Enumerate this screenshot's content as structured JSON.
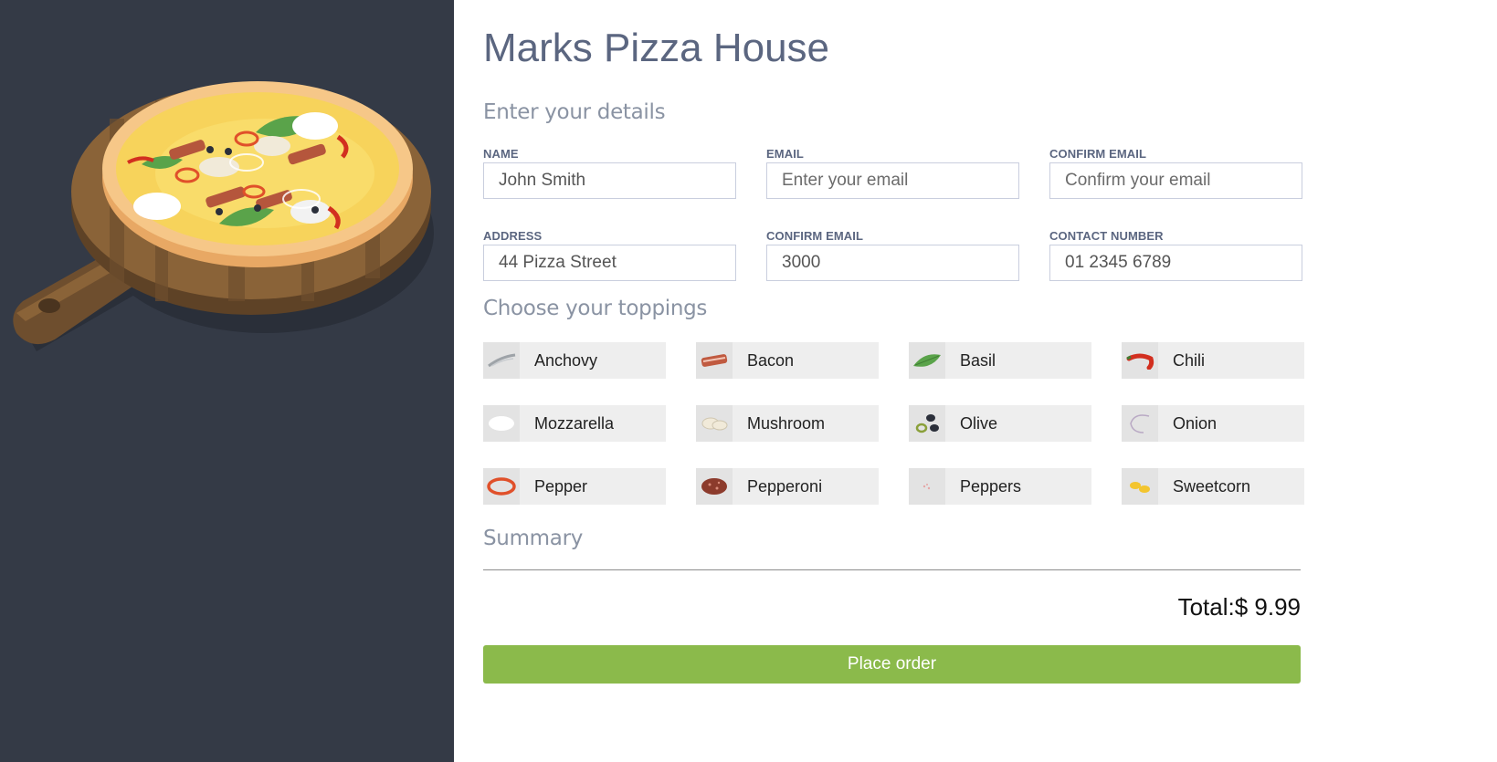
{
  "app": {
    "title": "Marks Pizza House"
  },
  "details": {
    "heading": "Enter your details",
    "fields": [
      {
        "label": "NAME",
        "value": "John Smith",
        "placeholder": ""
      },
      {
        "label": "EMAIL",
        "value": "",
        "placeholder": "Enter your email"
      },
      {
        "label": "CONFIRM EMAIL",
        "value": "",
        "placeholder": "Confirm your email"
      },
      {
        "label": "ADDRESS",
        "value": "44 Pizza Street",
        "placeholder": ""
      },
      {
        "label": "CONFIRM EMAIL",
        "value": "3000",
        "placeholder": ""
      },
      {
        "label": "CONTACT NUMBER",
        "value": "01 2345 6789",
        "placeholder": ""
      }
    ]
  },
  "toppings": {
    "heading": "Choose your toppings",
    "items": [
      {
        "label": "Anchovy",
        "icon": "anchovy-icon"
      },
      {
        "label": "Bacon",
        "icon": "bacon-icon"
      },
      {
        "label": "Basil",
        "icon": "basil-icon"
      },
      {
        "label": "Chili",
        "icon": "chili-icon"
      },
      {
        "label": "Mozzarella",
        "icon": "mozzarella-icon"
      },
      {
        "label": "Mushroom",
        "icon": "mushroom-icon"
      },
      {
        "label": "Olive",
        "icon": "olive-icon"
      },
      {
        "label": "Onion",
        "icon": "onion-icon"
      },
      {
        "label": "Pepper",
        "icon": "pepper-icon"
      },
      {
        "label": "Pepperoni",
        "icon": "pepperoni-icon"
      },
      {
        "label": "Peppers",
        "icon": "peppers-icon"
      },
      {
        "label": "Sweetcorn",
        "icon": "sweetcorn-icon"
      }
    ]
  },
  "summary": {
    "heading": "Summary",
    "total": "Total:$ 9.99"
  },
  "actions": {
    "place_order_label": "Place order"
  },
  "colors": {
    "sidebar_bg": "#343a46",
    "title": "#5b6680",
    "button": "#8bba4b",
    "topping_bg": "#eeeeee"
  }
}
